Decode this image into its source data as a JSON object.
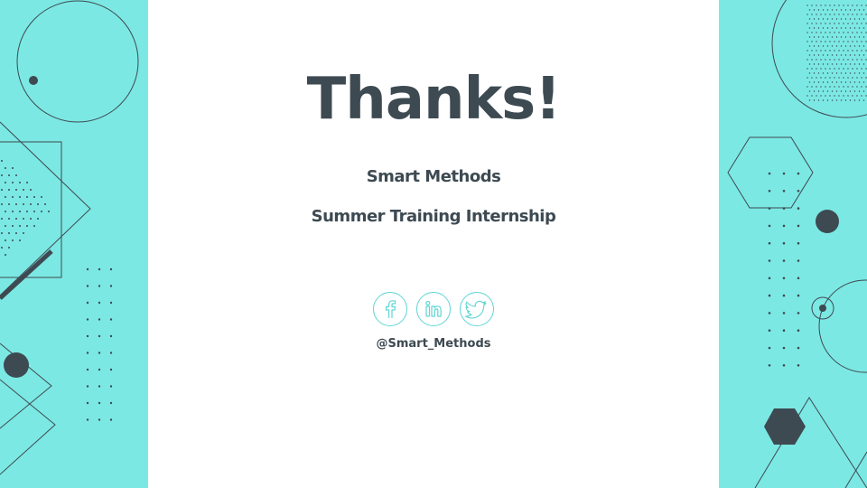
{
  "slide": {
    "title": "Thanks!",
    "subtitle_lines": [
      "Smart Methods",
      "Summer Training Internship"
    ],
    "social_handle": "@Smart_Methods"
  },
  "social_links": [
    {
      "network": "Facebook",
      "icon": "facebook-icon"
    },
    {
      "network": "LinkedIn",
      "icon": "linkedin-icon"
    },
    {
      "network": "Twitter",
      "icon": "twitter-icon"
    }
  ],
  "colors": {
    "panel_background": "#7ce8e3",
    "text_dark": "#3d4a52",
    "accent_outline": "#5fd6d3",
    "slide_background": "#ffffff"
  }
}
